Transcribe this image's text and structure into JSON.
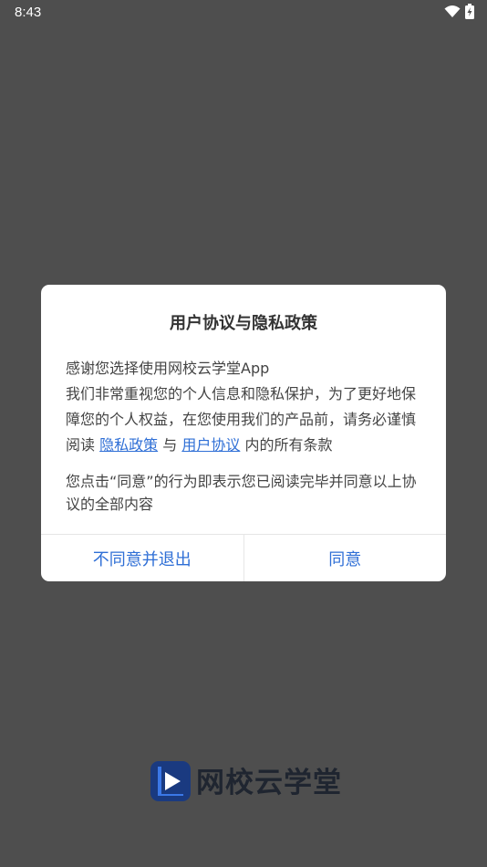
{
  "status_bar": {
    "time": "8:43",
    "icons": [
      "wifi-icon",
      "battery-charging-icon"
    ]
  },
  "dialog": {
    "title": "用户协议与隐私政策",
    "body": {
      "line1": "感谢您选择使用网校云学堂App",
      "line2": "我们非常重视您的个人信息和隐私保护，为了更好地保障您的个人权益，在您使用我们的产品前，请务必谨慎阅读",
      "link_privacy": "隐私政策",
      "conj": "与",
      "link_agreement": "用户协议",
      "line2_end": "内的所有条款",
      "para2": "您点击“同意”的行为即表示您已阅读完毕并同意以上协议的全部内容"
    },
    "buttons": {
      "decline": "不同意并退出",
      "agree": "同意"
    }
  },
  "brand": {
    "name": "网校云学堂",
    "logo_icon": "play-logo-icon"
  },
  "colors": {
    "overlay": "#4e4e4e",
    "dialog_bg": "#ffffff",
    "accent": "#2f6fd6",
    "title_text": "#333333",
    "body_text": "#444444",
    "logo": "#1a3a80"
  }
}
